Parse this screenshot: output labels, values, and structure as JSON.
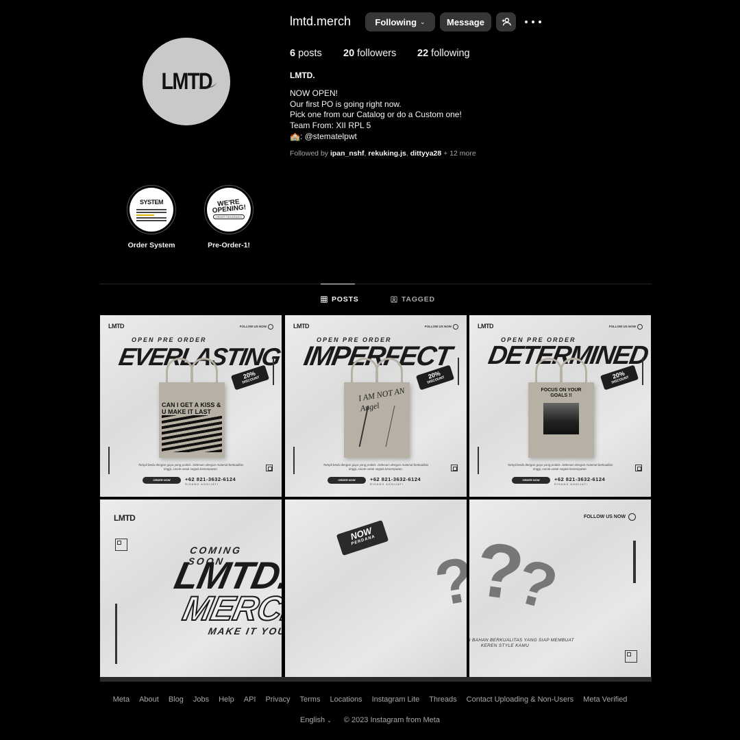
{
  "profile": {
    "avatar_text": "LMTD",
    "username": "lmtd.merch",
    "following_label": "Following",
    "message_label": "Message",
    "posts_count": "6",
    "posts_label": "posts",
    "followers_count": "20",
    "followers_label": "followers",
    "following_count": "22",
    "following_count_label": "following",
    "full_name": "LMTD.",
    "bio": "NOW OPEN!\nOur first PO is going right now.\nPick one from our Catalog or do a Custom one!\nTeam From: XII RPL 5\n🏫: @stematelpwt",
    "followed_by_prefix": "Followed by ",
    "followed_by_users": [
      "ipan_nshf",
      "rekuking.js",
      "dittyya28"
    ],
    "followed_by_more": "+ 12 more"
  },
  "highlights": [
    {
      "label": "Order System",
      "cover_text": "SYSTEM"
    },
    {
      "label": "Pre-Order-1!",
      "cover_text": "WE'RE OPENING!",
      "cover_sub": "ORDER SEKARANG!"
    }
  ],
  "tabs": [
    {
      "label": "POSTS",
      "active": true
    },
    {
      "label": "TAGGED",
      "active": false
    }
  ],
  "posts": [
    {
      "kicker": "OPEN PRE ORDER",
      "title": "EVERLASTING",
      "badge": "20%",
      "badge_sub": "DISCOUNT",
      "bag_print": "CAN I GET A KISS & U MAKE IT LAST FOREVER",
      "desc": "Tampil beda dengan gaya yang praktis. Didesain dengan material berkualitas tinggi, cocok untuk segala kesempatan.",
      "button": "ORDER NOW",
      "phone": "+62 821-3632-6124",
      "name": "RISANG AGNIJATI",
      "logo": "LMTD",
      "follow": "FOLLOW US NOW"
    },
    {
      "kicker": "OPEN PRE ORDER",
      "title": "IMPERFECT",
      "badge": "20%",
      "badge_sub": "DISCOUNT",
      "bag_print": "I AM NOT AN Angel",
      "desc": "Tampil beda dengan gaya yang praktis. Didesain dengan material berkualitas tinggi, cocok untuk segala kesempatan.",
      "button": "ORDER NOW",
      "phone": "+62 821-3632-6124",
      "name": "RISANG AGNIJATI",
      "logo": "LMTD",
      "follow": "FOLLOW US NOW"
    },
    {
      "kicker": "OPEN PRE ORDER",
      "title": "DETERMINED",
      "badge": "20%",
      "badge_sub": "DISCOUNT",
      "bag_print": "FOCUS ON YOUR GOALS !!",
      "desc": "Tampil beda dengan gaya yang praktis. Didesain dengan material berkualitas tinggi, cocok untuk segala kesempatan.",
      "button": "ORDER NOW",
      "phone": "+62 821-3632-6124",
      "name": "RISANG AGNIJATI",
      "logo": "LMTD",
      "follow": "FOLLOW US NOW"
    }
  ],
  "banner": {
    "logo": "LMTD",
    "coming": "COMING SOON",
    "line1": "LMTD.",
    "line2": "MERCH",
    "tagline": "MAKE IT YOURS!!",
    "now_tag": "NOW",
    "now_sub": "PERDANA",
    "qmark": "?",
    "follow": "FOLLOW US NOW",
    "desc": "TERBUAT DARI BAHAN BERKUALITAS YANG SIAP MEMBUAT KEREN STYLE KAMU"
  },
  "footer": {
    "links": [
      "Meta",
      "About",
      "Blog",
      "Jobs",
      "Help",
      "API",
      "Privacy",
      "Terms",
      "Locations",
      "Instagram Lite",
      "Threads",
      "Contact Uploading & Non-Users",
      "Meta Verified"
    ],
    "language": "English",
    "copyright": "© 2023 Instagram from Meta"
  }
}
